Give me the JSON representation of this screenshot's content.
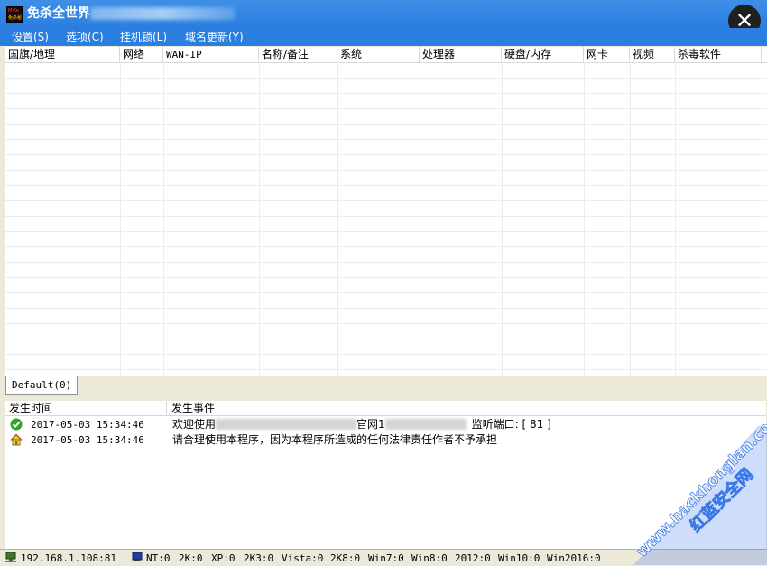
{
  "window": {
    "title": "免杀全世界",
    "icon_text_top": "MiKe",
    "icon_text_bottom": "免杀秘",
    "close_glyph": "✕"
  },
  "menu": [
    {
      "label": "设置(S)"
    },
    {
      "label": "选项(C)"
    },
    {
      "label": "挂机锁(L)"
    },
    {
      "label": "域名更新(Y)"
    }
  ],
  "grid": {
    "columns": [
      "国旗/地理",
      "网络",
      "WAN-IP",
      "名称/备注",
      "系统",
      "处理器",
      "硬盘/内存",
      "网卡",
      "视频",
      "杀毒软件"
    ]
  },
  "tabs": [
    {
      "label": "Default(0)"
    }
  ],
  "log": {
    "columns": [
      "发生时间",
      "发生事件"
    ],
    "rows": [
      {
        "icon": "check-icon",
        "time": "2017-05-03 15:34:46",
        "msg_prefix": "欢迎使用",
        "msg_mid": "官网",
        "msg_mid2": "1",
        "msg_suffix": "监听端口: [ 81 ]"
      },
      {
        "icon": "home-icon",
        "time": "2017-05-03 15:34:46",
        "msg": "请合理使用本程序，因为本程序所造成的任何法律责任作者不予承担"
      }
    ]
  },
  "status": {
    "ip": "192.168.1.108:81",
    "counts": [
      {
        "label": "NT:0"
      },
      {
        "label": "2K:0"
      },
      {
        "label": "XP:0"
      },
      {
        "label": "2K3:0"
      },
      {
        "label": "Vista:0"
      },
      {
        "label": "2K8:0"
      },
      {
        "label": "Win7:0"
      },
      {
        "label": "Win8:0"
      },
      {
        "label": "2012:0"
      },
      {
        "label": "Win10:0"
      },
      {
        "label": "Win2016:0"
      }
    ]
  },
  "watermark": {
    "line1": "www.hackhonglan.com",
    "line2": "红蓝安全网"
  },
  "colors": {
    "titlebar": "#2a7ee0",
    "close_button": "#202020",
    "watermark": "#3b78e7"
  }
}
